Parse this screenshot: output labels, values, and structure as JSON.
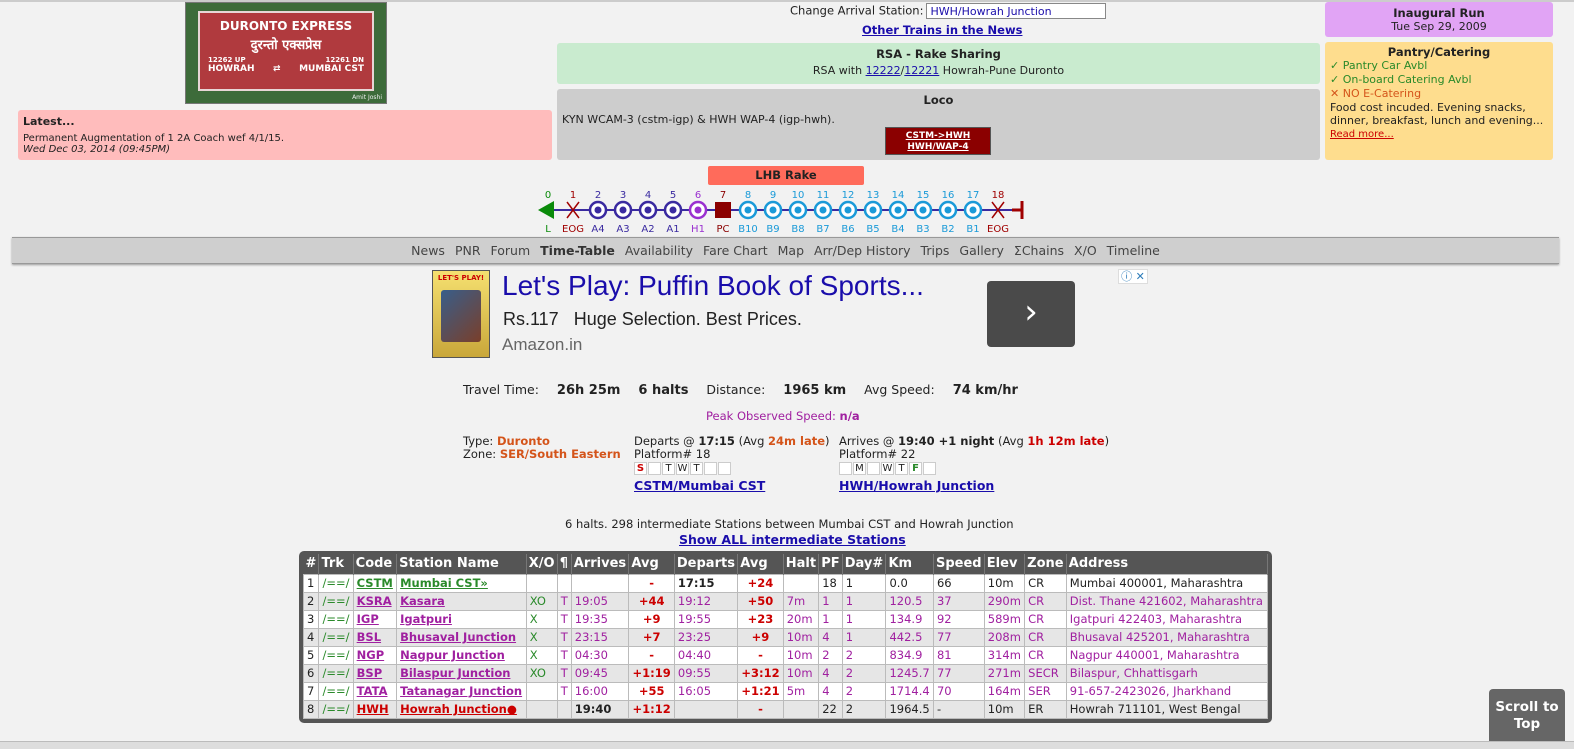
{
  "photo": {
    "line1": "DURONTO EXPRESS",
    "line2": "दुरन्तो एक्सप्रेस",
    "up": "12262 UP",
    "dn": "12261 DN",
    "from": "HOWRAH",
    "arrow": "⇄",
    "to": "MUMBAI CST",
    "watermark": "Amit Joshi"
  },
  "latest": {
    "title": "Latest...",
    "message": "Permanent Augmentation of 1 2A Coach wef 4/1/15.",
    "date": "Wed Dec 03, 2014 (09:45PM)"
  },
  "arrival": {
    "label": "Change Arrival Station:",
    "value": "HWH/Howrah Junction"
  },
  "other_trains": "Other Trains in the News",
  "rsa": {
    "title": "RSA - Rake Sharing",
    "prefix": "RSA with",
    "train1": "12222",
    "sep": "/",
    "train2": "12221",
    "suffix": "Howrah-Pune Duronto"
  },
  "loco": {
    "title": "Loco",
    "text": "KYN WCAM-3 (cstm-igp) & HWH WAP-4 (igp-hwh).",
    "button_line1": "CSTM->HWH",
    "button_line2": "HWH/WAP-4"
  },
  "inaugural": {
    "title": "Inaugural Run",
    "date": "Tue Sep 29, 2009"
  },
  "pantry": {
    "title": "Pantry/Catering",
    "item1": "✓ Pantry Car Avbl",
    "item2": "✓ On-board Catering Avbl",
    "item3": "✕ NO E-Catering",
    "note": "Food cost incuded. Evening snacks, dinner, breakfast, lunch and evening...",
    "more": "Read more..."
  },
  "rake": {
    "title": "LHB Rake",
    "coaches": [
      {
        "num": "0",
        "label": "L",
        "kind": "loco"
      },
      {
        "num": "1",
        "label": "EOG",
        "kind": "eog"
      },
      {
        "num": "2",
        "label": "A4",
        "kind": "ac"
      },
      {
        "num": "3",
        "label": "A3",
        "kind": "ac"
      },
      {
        "num": "4",
        "label": "A2",
        "kind": "ac"
      },
      {
        "num": "5",
        "label": "A1",
        "kind": "ac"
      },
      {
        "num": "6",
        "label": "H1",
        "kind": "first"
      },
      {
        "num": "7",
        "label": "PC",
        "kind": "pantry"
      },
      {
        "num": "8",
        "label": "B10",
        "kind": "b"
      },
      {
        "num": "9",
        "label": "B9",
        "kind": "b"
      },
      {
        "num": "10",
        "label": "B8",
        "kind": "b"
      },
      {
        "num": "11",
        "label": "B7",
        "kind": "b"
      },
      {
        "num": "12",
        "label": "B6",
        "kind": "b"
      },
      {
        "num": "13",
        "label": "B5",
        "kind": "b"
      },
      {
        "num": "14",
        "label": "B4",
        "kind": "b"
      },
      {
        "num": "15",
        "label": "B3",
        "kind": "b"
      },
      {
        "num": "16",
        "label": "B2",
        "kind": "b"
      },
      {
        "num": "17",
        "label": "B1",
        "kind": "b"
      },
      {
        "num": "18",
        "label": "EOG",
        "kind": "eog"
      }
    ],
    "colors": {
      "loco": "#0a8a0a",
      "eog": "#a00000",
      "ac": "#3a2aa0",
      "first": "#9a30d0",
      "pantry": "#8b0000",
      "b": "#1a9ad8"
    }
  },
  "nav": [
    "News",
    "PNR",
    "Forum",
    "Time-Table",
    "Availability",
    "Fare Chart",
    "Map",
    "Arr/Dep History",
    "Trips",
    "Gallery",
    "ΣChains",
    "X/O",
    "Timeline"
  ],
  "nav_active": "Time-Table",
  "ad": {
    "book_title": "LET'S PLAY!",
    "title": "Let's Play: Puffin Book of Sports...",
    "price": "Rs.117",
    "tagline": "Huge Selection. Best Prices.",
    "source": "Amazon.in",
    "go": "›",
    "info": "ⓘ ✕"
  },
  "stats": {
    "travel_label": "Travel Time:",
    "travel": "26h 25m",
    "halts": "6 halts",
    "distance_label": "Distance:",
    "distance": "1965 km",
    "speed_label": "Avg Speed:",
    "speed": "74 km/hr",
    "peak_label": "Peak Observed Speed:",
    "peak": "n/a"
  },
  "info": {
    "type_label": "Type:",
    "type": "Duronto",
    "zone_label": "Zone:",
    "zone": "SER/South Eastern"
  },
  "departs": {
    "label": "Departs @",
    "time": "17:15",
    "avg_pre": "(Avg",
    "avg": "24m late",
    "avg_post": ")",
    "platform": "Platform# 18",
    "days": [
      "S",
      "",
      "T",
      "W",
      "T",
      "",
      ""
    ],
    "station": "CSTM/Mumbai CST"
  },
  "arrives": {
    "label": "Arrives @",
    "time": "19:40 +1 night",
    "avg_pre": "(Avg",
    "avg": "1h 12m late",
    "avg_post": ")",
    "platform": "Platform# 22",
    "days": [
      "",
      "M",
      "",
      "W",
      "T",
      "F",
      ""
    ],
    "station": "HWH/Howrah Junction"
  },
  "halts_text": "6 halts. 298 intermediate Stations between Mumbai CST and Howrah Junction",
  "show_all": "Show ALL intermediate Stations",
  "table": {
    "headers": [
      "#",
      "Trk",
      "Code",
      "Station Name",
      "X/O",
      "¶",
      "Arrives",
      "Avg",
      "Departs",
      "Avg",
      "Halt",
      "PF",
      "Day#",
      "Km",
      "Speed",
      "Elev",
      "Zone",
      "Address"
    ],
    "rows": [
      [
        "1",
        "/==/",
        "CSTM",
        "Mumbai CST»",
        "",
        "",
        "",
        "-",
        "17:15",
        "+24",
        "",
        "18",
        "1",
        "0.0",
        "66",
        "10m",
        "CR",
        "Mumbai 400001, Maharashtra"
      ],
      [
        "2",
        "/==/",
        "KSRA",
        "Kasara",
        "XO",
        "T",
        "19:05",
        "+44",
        "19:12",
        "+50",
        "7m",
        "1",
        "1",
        "120.5",
        "37",
        "290m",
        "CR",
        "Dist. Thane 421602, Maharashtra"
      ],
      [
        "3",
        "/==/",
        "IGP",
        "Igatpuri",
        "X",
        "T",
        "19:35",
        "+9",
        "19:55",
        "+23",
        "20m",
        "1",
        "1",
        "134.9",
        "92",
        "589m",
        "CR",
        "Igatpuri 422403, Maharashtra"
      ],
      [
        "4",
        "/==/",
        "BSL",
        "Bhusaval Junction",
        "X",
        "T",
        "23:15",
        "+7",
        "23:25",
        "+9",
        "10m",
        "4",
        "1",
        "442.5",
        "77",
        "208m",
        "CR",
        "Bhusaval 425201, Maharashtra"
      ],
      [
        "5",
        "/==/",
        "NGP",
        "Nagpur Junction",
        "X",
        "T",
        "04:30",
        "-",
        "04:40",
        "-",
        "10m",
        "2",
        "2",
        "834.9",
        "81",
        "314m",
        "CR",
        "Nagpur 440001, Maharashtra"
      ],
      [
        "6",
        "/==/",
        "BSP",
        "Bilaspur Junction",
        "XO",
        "T",
        "09:45",
        "+1:19",
        "09:55",
        "+3:12",
        "10m",
        "4",
        "2",
        "1245.7",
        "77",
        "271m",
        "SECR",
        "Bilaspur, Chhattisgarh"
      ],
      [
        "7",
        "/==/",
        "TATA",
        "Tatanagar Junction",
        "",
        "T",
        "16:00",
        "+55",
        "16:05",
        "+1:21",
        "5m",
        "4",
        "2",
        "1714.4",
        "70",
        "164m",
        "SER",
        "91-657-2423026, Jharkhand"
      ],
      [
        "8",
        "/==/",
        "HWH",
        "Howrah Junction●",
        "",
        "",
        "19:40",
        "+1:12",
        "",
        "-",
        "",
        "22",
        "2",
        "1964.5",
        "-",
        "10m",
        "ER",
        "Howrah 711101, West Bengal"
      ]
    ]
  },
  "scroll_top": "Scroll to Top"
}
